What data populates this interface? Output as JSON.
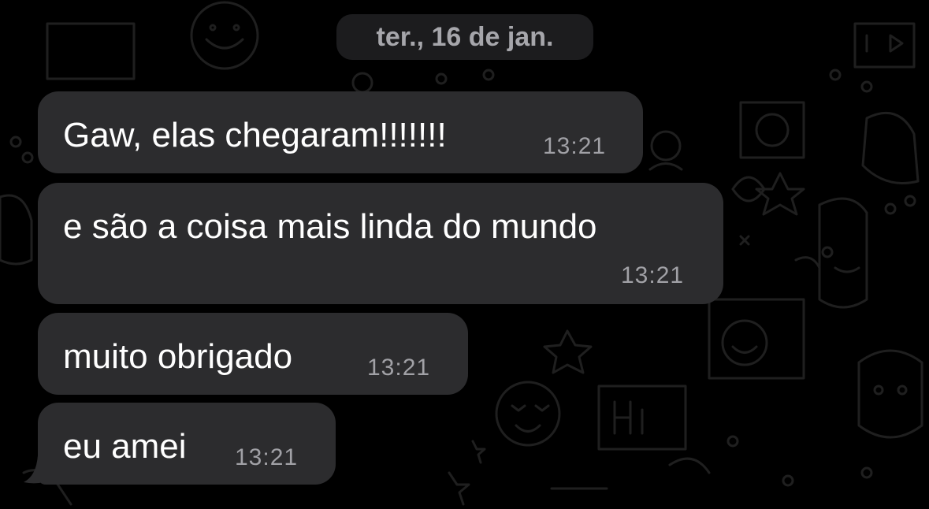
{
  "chat": {
    "date_separator": "ter., 16 de jan.",
    "messages": [
      {
        "text": "Gaw, elas chegaram!!!!!!!",
        "time": "13:21"
      },
      {
        "text": "e são a coisa mais linda do mundo",
        "time": "13:21"
      },
      {
        "text": "muito obrigado",
        "time": "13:21"
      },
      {
        "text": "eu amei",
        "time": "13:21"
      }
    ]
  },
  "colors": {
    "background": "#000000",
    "bubble": "#2c2c2e",
    "date_pill": "#1c1c1e",
    "timestamp": "#a1a1a6",
    "date_text": "#a6a6ab"
  }
}
